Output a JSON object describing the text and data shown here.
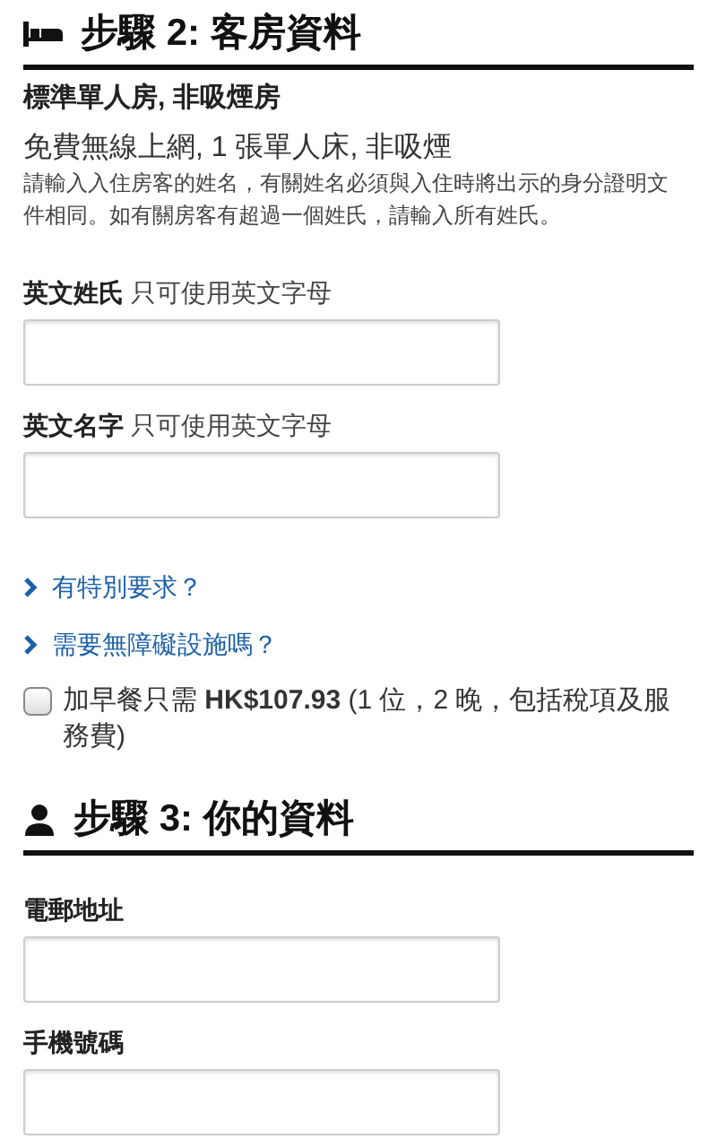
{
  "sections": [
    {
      "kind": "room",
      "title": "步驟 2: 客房資料",
      "room_name": "標準單人房, 非吸煙房",
      "amenities": "免費無線上網, 1 張單人床, 非吸煙",
      "notice": "請輸入入住房客的姓名，有關姓名必須與入住時將出示的身分證明文件相同。如有關房客有超過一個姓氏，請輸入所有姓氏。",
      "fields": [
        {
          "label": "英文姓氏",
          "hint": "只可使用英文字母"
        },
        {
          "label": "英文名字",
          "hint": "只可使用英文字母"
        }
      ],
      "links": [
        "有特別要求？",
        "需要無障礙設施嗎？"
      ],
      "breakfast": {
        "text": "加早餐只需 **HK$107.93** (1 位，2 晚，包括稅項及服務費)",
        "checked": false
      }
    },
    {
      "kind": "guest",
      "title": "步驟 3: 你的資料",
      "fields": [
        {
          "label": "電郵地址"
        },
        {
          "label": "手機號碼"
        }
      ]
    }
  ]
}
